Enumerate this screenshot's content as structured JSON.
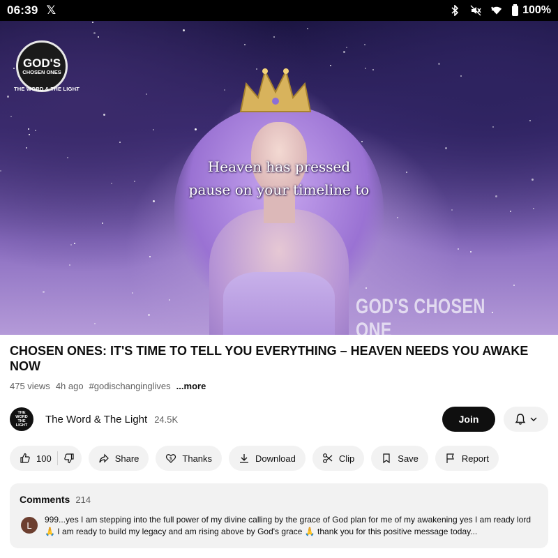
{
  "status_bar": {
    "time": "06:39",
    "x_app_glyph": "𝕏",
    "battery": "100%",
    "icons": [
      "bluetooth-icon",
      "mute-icon",
      "wifi-icon",
      "battery-icon"
    ]
  },
  "video": {
    "channel_logo": {
      "main": "GOD'S",
      "sub": "CHOSEN ONES",
      "caption": "THE WORD & THE LIGHT"
    },
    "overlay_line1": "Heaven has pressed",
    "overlay_line2": "pause on your timeline to",
    "watermark": "GOD'S CHOSEN ONE"
  },
  "title": "CHOSEN ONES: IT'S TIME TO TELL YOU EVERYTHING – HEAVEN NEEDS YOU AWAKE NOW",
  "meta": {
    "views": "475 views",
    "time_ago": "4h ago",
    "hashtag": "#godischanginglives",
    "more": "...more"
  },
  "channel": {
    "avatar_text": "THE WORD THE LIGHT",
    "name": "The Word & The Light",
    "subscribers": "24.5K",
    "join_label": "Join"
  },
  "actions": {
    "likes": "100",
    "share": "Share",
    "thanks": "Thanks",
    "download": "Download",
    "clip": "Clip",
    "save": "Save",
    "report": "Report"
  },
  "comments": {
    "title": "Comments",
    "count": "214",
    "avatar_letter": "L",
    "top_comment": "999...yes I am stepping into the full power of my divine calling by the grace of God plan for me of my awakening yes I am ready lord 🙏 I am ready to build my legacy and am rising above by God's grace 🙏 thank you for this positive message today..."
  },
  "colors": {
    "accent_dark": "#0f0f0f",
    "pill_bg": "#f2f2f2",
    "secondary_text": "#606060"
  }
}
